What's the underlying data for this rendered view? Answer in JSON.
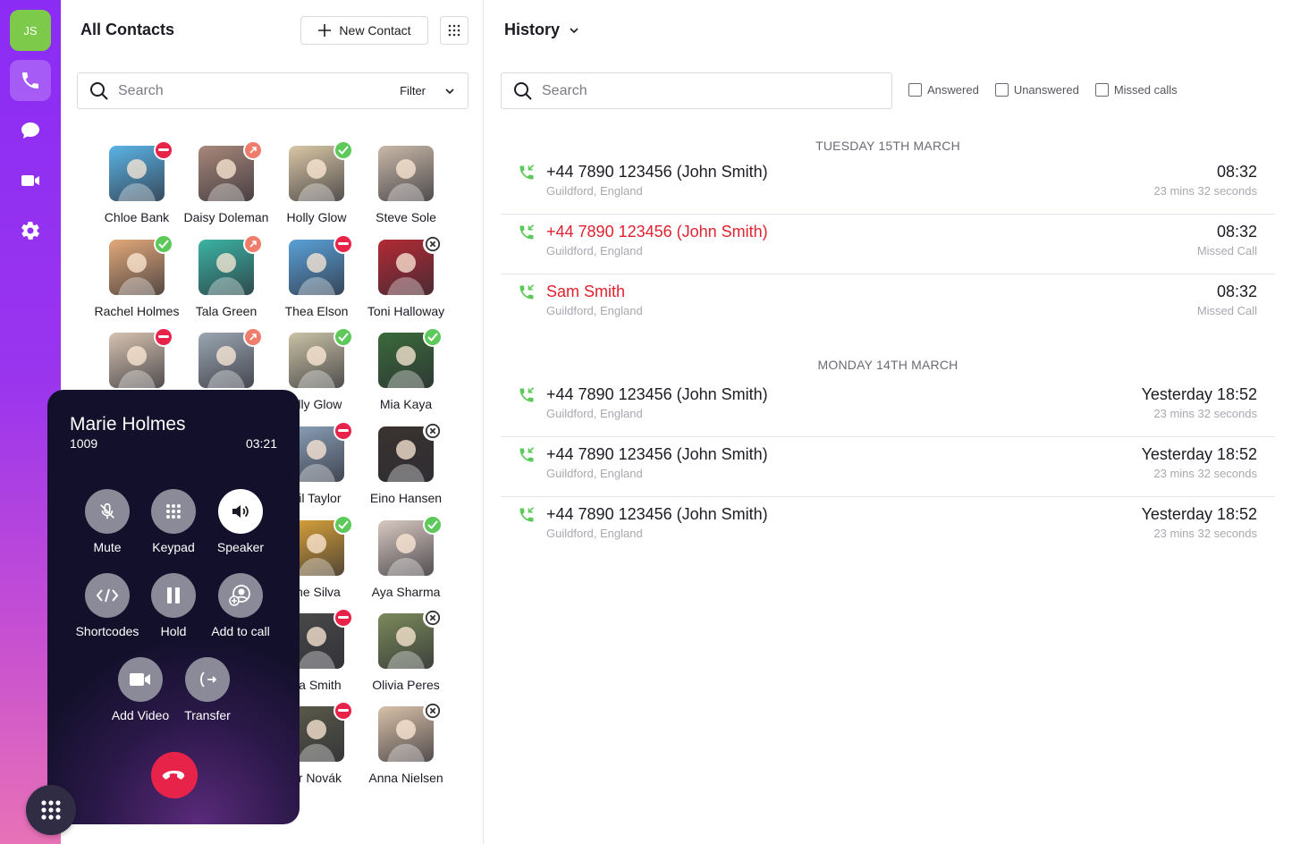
{
  "rail": {
    "avatar_initials": "JS",
    "avatar_color": "#7dc94a",
    "items": [
      "phone-icon",
      "chat-icon",
      "video-icon",
      "gear-icon"
    ]
  },
  "contacts": {
    "title": "All Contacts",
    "new_contact_label": "New Contact",
    "search_placeholder": "Search",
    "filter_label": "Filter",
    "list": [
      {
        "name": "Chloe Bank",
        "status": "busy",
        "color": "#5bb3e6"
      },
      {
        "name": "Daisy Doleman",
        "status": "away",
        "color": "#a8877a"
      },
      {
        "name": "Holly Glow",
        "status": "online",
        "color": "#d9c7a5"
      },
      {
        "name": "Steve Sole",
        "status": "none",
        "color": "#c9b8a8"
      },
      {
        "name": "Rachel Holmes",
        "status": "online",
        "color": "#e2a97a"
      },
      {
        "name": "Tala Green",
        "status": "away",
        "color": "#3bb3a4"
      },
      {
        "name": "Thea Elson",
        "status": "busy",
        "color": "#5aa0d8"
      },
      {
        "name": "Toni Halloway",
        "status": "offline",
        "color": "#b32a34"
      },
      {
        "name": "",
        "status": "busy",
        "color": "#d6c2b0"
      },
      {
        "name": "",
        "status": "away",
        "color": "#9aa6b2"
      },
      {
        "name": "olly Glow",
        "status": "online",
        "color": "#c9c2a5"
      },
      {
        "name": "Mia Kaya",
        "status": "online",
        "color": "#3a6a3a"
      },
      {
        "name": "",
        "status": "none",
        "color": "#ffffff"
      },
      {
        "name": "",
        "status": "none",
        "color": "#ffffff"
      },
      {
        "name": "hil Taylor",
        "status": "busy",
        "color": "#8aa0b8"
      },
      {
        "name": "Eino Hansen",
        "status": "offline",
        "color": "#3a3330"
      },
      {
        "name": "",
        "status": "none",
        "color": "#ffffff"
      },
      {
        "name": "",
        "status": "none",
        "color": "#ffffff"
      },
      {
        "name": "fne Silva",
        "status": "online",
        "color": "#d9a23a"
      },
      {
        "name": "Aya Sharma",
        "status": "online",
        "color": "#d8c8c0"
      },
      {
        "name": "",
        "status": "none",
        "color": "#ffffff"
      },
      {
        "name": "",
        "status": "none",
        "color": "#ffffff"
      },
      {
        "name": "ria Smith",
        "status": "busy",
        "color": "#4a4a4a"
      },
      {
        "name": "Olivia Peres",
        "status": "offline",
        "color": "#7a8a5a"
      },
      {
        "name": "",
        "status": "none",
        "color": "#ffffff"
      },
      {
        "name": "",
        "status": "none",
        "color": "#ffffff"
      },
      {
        "name": "ar Novák",
        "status": "busy",
        "color": "#5a5a4a"
      },
      {
        "name": "Anna Nielsen",
        "status": "offline",
        "color": "#d8c0a8"
      }
    ]
  },
  "call": {
    "name": "Marie Holmes",
    "extension": "1009",
    "timer": "03:21",
    "buttons": {
      "mute": "Mute",
      "keypad": "Keypad",
      "speaker": "Speaker",
      "shortcodes": "Shortcodes",
      "hold": "Hold",
      "add_to_call": "Add to call",
      "add_video": "Add Video",
      "transfer": "Transfer"
    }
  },
  "history": {
    "title": "History",
    "search_placeholder": "Search",
    "filters": [
      "Answered",
      "Unanswered",
      "Missed calls"
    ],
    "groups": [
      {
        "date": "TUESDAY 15TH MARCH",
        "calls": [
          {
            "title": "+44 7890 123456 (John Smith)",
            "location": "Guildford, England",
            "time": "08:32",
            "detail": "23 mins 32 seconds",
            "missed": false
          },
          {
            "title": "+44 7890 123456 (John Smith)",
            "location": "Guildford, England",
            "time": "08:32",
            "detail": "Missed Call",
            "missed": true
          },
          {
            "title": "Sam Smith",
            "location": "Guildford, England",
            "time": "08:32",
            "detail": "Missed Call",
            "missed": true
          }
        ]
      },
      {
        "date": "MONDAY 14TH MARCH",
        "calls": [
          {
            "title": "+44 7890 123456 (John Smith)",
            "location": "Guildford, England",
            "time": "Yesterday 18:52",
            "detail": "23 mins 32 seconds",
            "missed": false
          },
          {
            "title": "+44 7890 123456 (John Smith)",
            "location": "Guildford, England",
            "time": "Yesterday 18:52",
            "detail": "23 mins 32 seconds",
            "missed": false
          },
          {
            "title": "+44 7890 123456 (John Smith)",
            "location": "Guildford, England",
            "time": "Yesterday 18:52",
            "detail": "23 mins 32 seconds",
            "missed": false
          }
        ]
      }
    ]
  },
  "colors": {
    "accent": "#8b2cf5",
    "missed": "#e0212f",
    "answered_icon": "#5cc95a",
    "hangup": "#e8234a"
  }
}
